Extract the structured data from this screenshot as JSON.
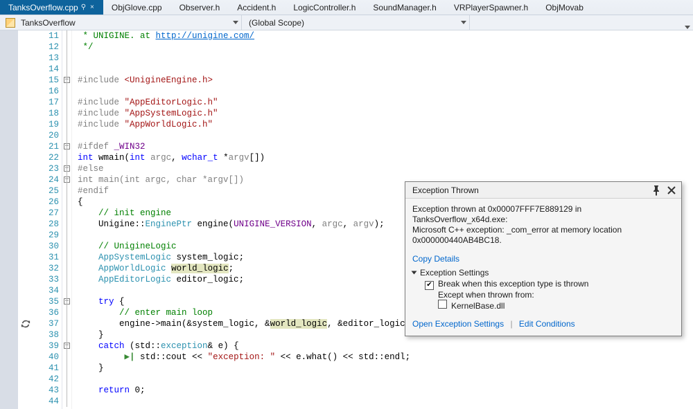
{
  "tabs": {
    "active": "TanksOverflow.cpp",
    "items": [
      "TanksOverflow.cpp",
      "ObjGlove.cpp",
      "Observer.h",
      "Accident.h",
      "LogicController.h",
      "SoundManager.h",
      "VRPlayerSpawner.h",
      "ObjMovab"
    ],
    "pin_glyph": "📌",
    "close_glyph": "×"
  },
  "nav": {
    "doc": "TanksOverflow",
    "scope": "(Global Scope)"
  },
  "line_start": 11,
  "line_end": 44,
  "code": {
    "11": {
      "indent": 0,
      "frags": [
        [
          "c-green",
          " * UNIGINE. at "
        ],
        [
          "c-link",
          "http://unigine.com/"
        ]
      ]
    },
    "12": {
      "indent": 0,
      "frags": [
        [
          "c-green",
          " */"
        ]
      ]
    },
    "13": {
      "indent": 0,
      "frags": [
        [
          "",
          ""
        ]
      ]
    },
    "14": {
      "indent": 0,
      "frags": [
        [
          "",
          ""
        ]
      ]
    },
    "15": {
      "indent": 0,
      "box": "-",
      "frags": [
        [
          "c-gray",
          "#include "
        ],
        [
          "c-brown",
          "<UnigineEngine.h>"
        ]
      ]
    },
    "16": {
      "indent": 0,
      "frags": [
        [
          "",
          ""
        ]
      ]
    },
    "17": {
      "indent": 0,
      "frags": [
        [
          "c-gray",
          "#include "
        ],
        [
          "c-brown",
          "\"AppEditorLogic.h\""
        ]
      ]
    },
    "18": {
      "indent": 0,
      "frags": [
        [
          "c-gray",
          "#include "
        ],
        [
          "c-brown",
          "\"AppSystemLogic.h\""
        ]
      ]
    },
    "19": {
      "indent": 0,
      "frags": [
        [
          "c-gray",
          "#include "
        ],
        [
          "c-brown",
          "\"AppWorldLogic.h\""
        ]
      ]
    },
    "20": {
      "indent": 0,
      "frags": [
        [
          "",
          ""
        ]
      ]
    },
    "21": {
      "indent": 0,
      "box": "-",
      "frags": [
        [
          "c-gray",
          "#ifdef "
        ],
        [
          "c-macro",
          "_WIN32"
        ]
      ]
    },
    "22": {
      "indent": 0,
      "frags": [
        [
          "c-blue",
          "int"
        ],
        [
          "",
          " wmain("
        ],
        [
          "c-blue",
          "int"
        ],
        [
          "",
          " "
        ],
        [
          "c-gray",
          "argc"
        ],
        [
          "",
          ", "
        ],
        [
          "c-blue",
          "wchar_t"
        ],
        [
          "",
          " *"
        ],
        [
          "c-gray",
          "argv"
        ],
        [
          "",
          "[])"
        ]
      ]
    },
    "23": {
      "indent": 0,
      "box": "-",
      "frags": [
        [
          "c-gray",
          "#else"
        ]
      ]
    },
    "24": {
      "indent": 0,
      "box": "-",
      "disabled": true,
      "frags": [
        [
          "c-gray",
          "int main(int argc, char *argv[])"
        ]
      ]
    },
    "25": {
      "indent": 0,
      "frags": [
        [
          "c-gray",
          "#endif"
        ]
      ]
    },
    "26": {
      "indent": 0,
      "frags": [
        [
          "",
          "{"
        ]
      ]
    },
    "27": {
      "indent": 1,
      "frags": [
        [
          "c-green",
          "// init engine"
        ]
      ]
    },
    "28": {
      "indent": 1,
      "frags": [
        [
          "",
          "Unigine::"
        ],
        [
          "c-type",
          "EnginePtr"
        ],
        [
          "",
          " engine("
        ],
        [
          "c-macro",
          "UNIGINE_VERSION"
        ],
        [
          "",
          ", "
        ],
        [
          "c-gray",
          "argc"
        ],
        [
          "",
          ", "
        ],
        [
          "c-gray",
          "argv"
        ],
        [
          "",
          ");"
        ]
      ]
    },
    "29": {
      "indent": 0,
      "frags": [
        [
          "",
          ""
        ]
      ]
    },
    "30": {
      "indent": 1,
      "frags": [
        [
          "c-green",
          "// UnigineLogic"
        ]
      ]
    },
    "31": {
      "indent": 1,
      "frags": [
        [
          "c-type",
          "AppSystemLogic"
        ],
        [
          "",
          " system_logic;"
        ]
      ]
    },
    "32": {
      "indent": 1,
      "frags": [
        [
          "c-type",
          "AppWorldLogic"
        ],
        [
          "",
          " "
        ],
        [
          "hl",
          "world_logic"
        ],
        [
          "",
          ";"
        ]
      ]
    },
    "33": {
      "indent": 1,
      "frags": [
        [
          "c-type",
          "AppEditorLogic"
        ],
        [
          "",
          " editor_logic;"
        ]
      ]
    },
    "34": {
      "indent": 0,
      "frags": [
        [
          "",
          ""
        ]
      ]
    },
    "35": {
      "indent": 1,
      "box": "-",
      "frags": [
        [
          "c-blue",
          "try"
        ],
        [
          "",
          " {"
        ]
      ]
    },
    "36": {
      "indent": 2,
      "frags": [
        [
          "c-green",
          "// enter main loop"
        ]
      ]
    },
    "37": {
      "indent": 2,
      "margin": "sync",
      "err": true,
      "frags": [
        [
          "",
          "engine->main(&system_logic, &"
        ],
        [
          "hl",
          "world_logic"
        ],
        [
          "",
          ", &editor_logic);"
        ]
      ]
    },
    "38": {
      "indent": 1,
      "frags": [
        [
          "",
          "}"
        ]
      ]
    },
    "39": {
      "indent": 1,
      "box": "-",
      "frags": [
        [
          "c-blue",
          "catch"
        ],
        [
          "",
          " (std::"
        ],
        [
          "c-type",
          "exception"
        ],
        [
          "",
          "& e) {"
        ]
      ]
    },
    "40": {
      "indent": 2,
      "frags": [
        [
          "run-arrow",
          " ▶| "
        ],
        [
          "",
          "std::cout << "
        ],
        [
          "c-brown",
          "\"exception: \""
        ],
        [
          "",
          " << e.what() << std::endl;"
        ]
      ]
    },
    "41": {
      "indent": 1,
      "frags": [
        [
          "",
          "}"
        ]
      ]
    },
    "42": {
      "indent": 0,
      "frags": [
        [
          "",
          ""
        ]
      ]
    },
    "43": {
      "indent": 1,
      "frags": [
        [
          "c-blue",
          "return"
        ],
        [
          "",
          " 0;"
        ]
      ]
    },
    "44": {
      "indent": 0,
      "frags": [
        [
          "",
          ""
        ]
      ]
    }
  },
  "popup": {
    "title": "Exception Thrown",
    "msg1": "Exception thrown at 0x00007FFF7E889129 in TanksOverflow_x64d.exe:",
    "msg2": "Microsoft C++ exception: _com_error at memory location",
    "msg3": "0x000000440AB4BC18.",
    "copy": "Copy Details",
    "settings_hdr": "Exception Settings",
    "chk1_label": "Break when this exception type is thrown",
    "except_label": "Except when thrown from:",
    "chk2_label": "KernelBase.dll",
    "link_open": "Open Exception Settings",
    "link_edit": "Edit Conditions",
    "pin_glyph": "📌",
    "close_glyph": "✕"
  }
}
